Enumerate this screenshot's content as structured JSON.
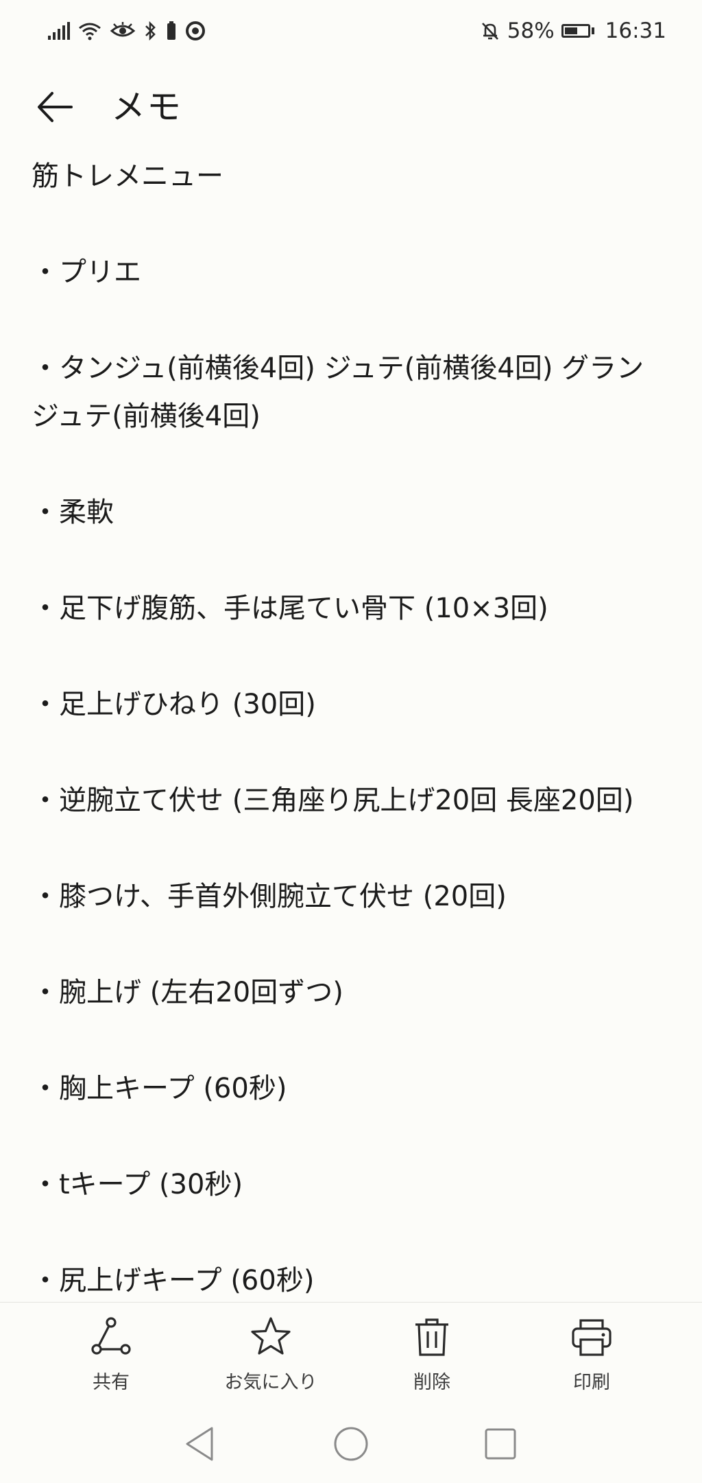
{
  "status_bar": {
    "battery_percent": "58%",
    "battery_level": 0.58,
    "time": "16:31",
    "icons": [
      "signal-icon",
      "wifi-icon",
      "eye-icon",
      "bluetooth-icon",
      "battery-small-icon",
      "record-icon",
      "silent-bell-icon",
      "battery-icon"
    ]
  },
  "header": {
    "title": "メモ",
    "back_icon": "arrow-left-icon"
  },
  "note": {
    "lines": [
      "筋トレメニュー",
      "",
      "・プリエ",
      "",
      "・タンジュ(前横後4回) ジュテ(前横後4回) グラン",
      "ジュテ(前横後4回)",
      "",
      "・柔軟",
      "",
      "・足下げ腹筋、手は尾てい骨下 (10×3回)",
      "",
      "・足上げひねり (30回)",
      "",
      "・逆腕立て伏せ (三角座り尻上げ20回 長座20回)",
      "",
      "・膝つけ、手首外側腕立て伏せ (20回)",
      "",
      "・腕上げ (左右20回ずつ)",
      "",
      "・胸上キープ (60秒)",
      "",
      "・tキープ (30秒)",
      "",
      "・尻上げキープ (60秒)"
    ]
  },
  "toolbar": {
    "share_label": "共有",
    "favorite_label": "お気に入り",
    "delete_label": "削除",
    "print_label": "印刷"
  },
  "nav": {
    "icons": [
      "nav-back-icon",
      "nav-home-icon",
      "nav-recents-icon"
    ]
  },
  "colors": {
    "background": "#fcfcf9",
    "text": "#1b1b1b",
    "icon": "#2a2a2a",
    "divider": "#e4e4e0"
  }
}
